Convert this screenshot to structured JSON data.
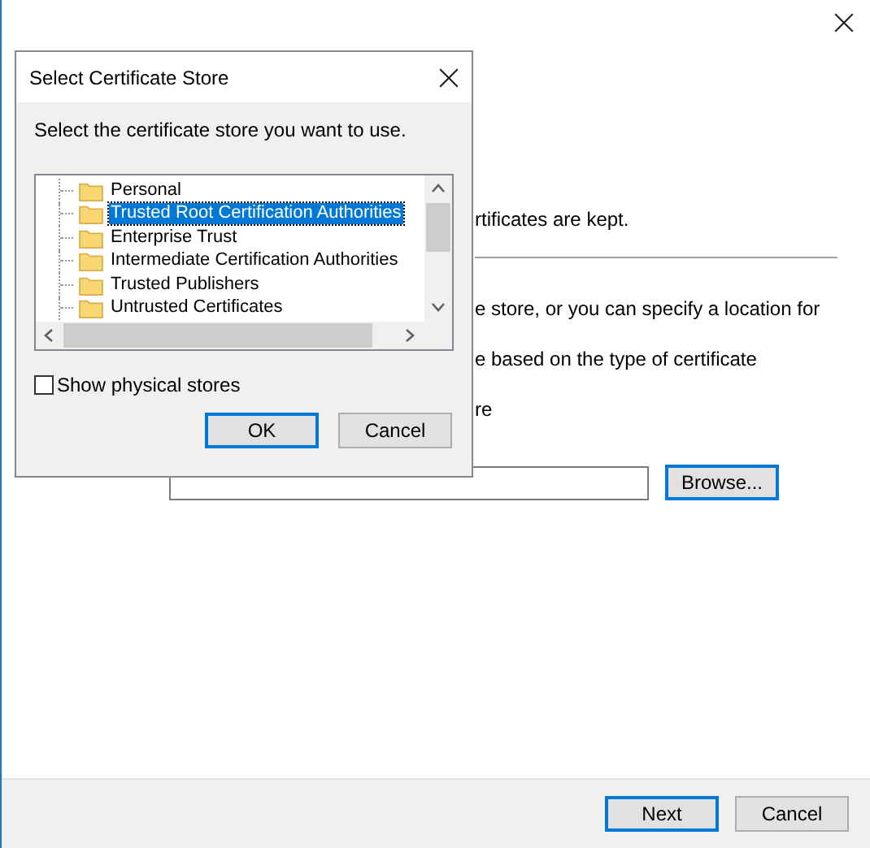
{
  "wizard": {
    "lines": [
      {
        "kind": "text",
        "text": "rtificates are kept."
      },
      {
        "kind": "rule"
      },
      {
        "kind": "text",
        "text": "e store, or you can specify a location for"
      },
      {
        "kind": "text",
        "text": "e based on the type of certificate"
      },
      {
        "kind": "text",
        "text": "re"
      }
    ],
    "browse": "Browse...",
    "buttons": [
      {
        "label": "Next",
        "default": true
      },
      {
        "label": "Cancel",
        "default": false
      }
    ]
  },
  "dialog": {
    "title": "Select Certificate Store",
    "prompt": "Select the certificate store you want to use.",
    "stores": [
      {
        "label": "Personal",
        "selected": false
      },
      {
        "label": "Trusted Root Certification Authorities",
        "selected": true
      },
      {
        "label": "Enterprise Trust",
        "selected": false
      },
      {
        "label": "Intermediate Certification Authorities",
        "selected": false
      },
      {
        "label": "Trusted Publishers",
        "selected": false
      },
      {
        "label": "Untrusted Certificates",
        "selected": false
      }
    ],
    "show_physical": {
      "label": "Show physical stores",
      "checked": false
    },
    "buttons": [
      {
        "label": "OK",
        "default": true
      },
      {
        "label": "Cancel",
        "default": false
      }
    ]
  }
}
